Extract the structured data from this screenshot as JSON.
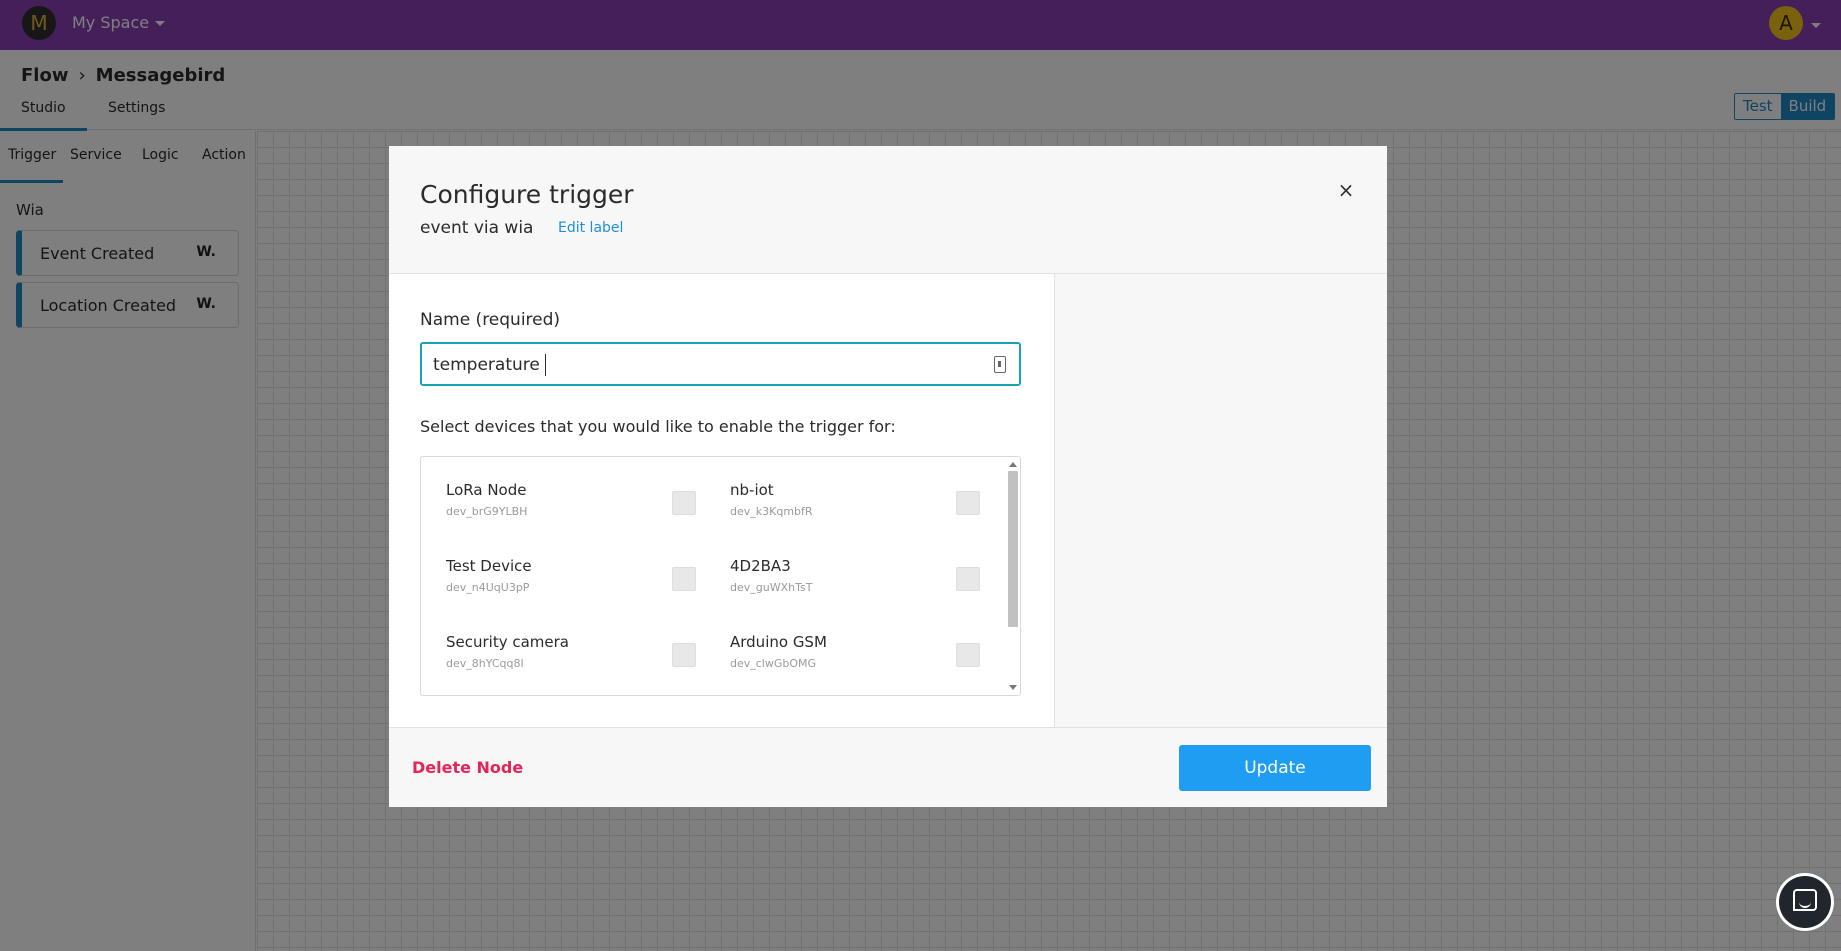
{
  "topbar": {
    "space_initial": "M",
    "space_name": "My Space",
    "user_initial": "A"
  },
  "header": {
    "breadcrumb": [
      "Flow",
      "Messagebird"
    ],
    "breadcrumb_separator": "›",
    "tabs": [
      {
        "label": "Studio",
        "active": true
      },
      {
        "label": "Settings",
        "active": false
      }
    ],
    "mode": {
      "test_label": "Test",
      "build_label": "Build",
      "active": "Build"
    }
  },
  "sidebar": {
    "tabs": [
      {
        "label": "Trigger",
        "active": true
      },
      {
        "label": "Service",
        "active": false
      },
      {
        "label": "Logic",
        "active": false
      },
      {
        "label": "Action",
        "active": false
      }
    ],
    "section": "Wia",
    "items": [
      {
        "label": "Event Created",
        "logo": "W."
      },
      {
        "label": "Location Created",
        "logo": "W."
      }
    ]
  },
  "modal": {
    "title": "Configure trigger",
    "subtitle": "event via wia",
    "edit_label": "Edit label",
    "name_label": "Name (required)",
    "name_value": "temperature",
    "devices_label": "Select devices that you would like to enable the trigger for:",
    "devices": [
      {
        "name": "LoRa Node",
        "id": "dev_brG9YLBH",
        "checked": false
      },
      {
        "name": "nb-iot",
        "id": "dev_k3KqmbfR",
        "checked": false
      },
      {
        "name": "Test Device",
        "id": "dev_n4UqU3pP",
        "checked": false
      },
      {
        "name": "4D2BA3",
        "id": "dev_guWXhTsT",
        "checked": false
      },
      {
        "name": "Security camera",
        "id": "dev_8hYCqq8I",
        "checked": false
      },
      {
        "name": "Arduino GSM",
        "id": "dev_clwGbOMG",
        "checked": false
      }
    ],
    "delete_label": "Delete Node",
    "update_label": "Update"
  },
  "colors": {
    "topbar": "#8a3fb3",
    "accent": "#1e88c7",
    "update_button": "#1e9df2",
    "delete_text": "#e4245a",
    "input_focus": "#1aa1b8"
  },
  "icons": [
    "close-icon",
    "keychain-icon",
    "chat-icon",
    "caret-down-icon",
    "wia-logo-icon"
  ]
}
